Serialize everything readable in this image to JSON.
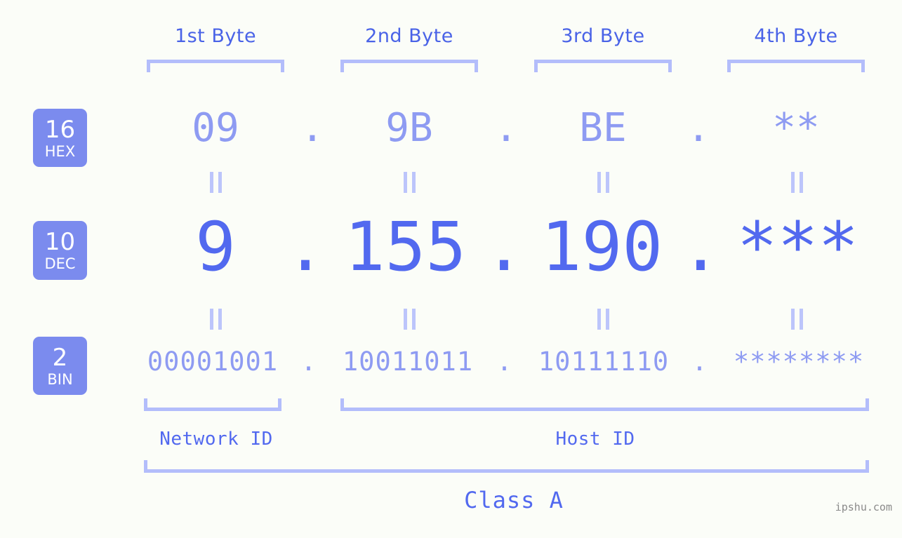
{
  "headers": [
    {
      "label": "1st Byte"
    },
    {
      "label": "2nd Byte"
    },
    {
      "label": "3rd Byte"
    },
    {
      "label": "4th Byte"
    }
  ],
  "bases": [
    {
      "number": "16",
      "name": "HEX"
    },
    {
      "number": "10",
      "name": "DEC"
    },
    {
      "number": "2",
      "name": "BIN"
    }
  ],
  "rows": {
    "hex": {
      "octets": [
        "09",
        "9B",
        "BE",
        "**"
      ],
      "separator": "."
    },
    "dec": {
      "octets": [
        "9",
        "155",
        "190",
        "***"
      ],
      "separator": "."
    },
    "bin": {
      "octets": [
        "00001001",
        "10011011",
        "10111110",
        "********"
      ],
      "separator": "."
    }
  },
  "sections": {
    "network_id": "Network ID",
    "host_id": "Host ID",
    "class": "Class A"
  },
  "watermark": "ipshu.com",
  "colors": {
    "background": "#fbfdf8",
    "accent_strong": "#5269ef",
    "accent_light": "#8e9bf2",
    "bracket": "#b3bdfb",
    "badge_bg": "#7b8bee",
    "badge_text": "#ffffff",
    "header_text": "#4a63e7",
    "watermark_text": "#8a8a8a"
  }
}
